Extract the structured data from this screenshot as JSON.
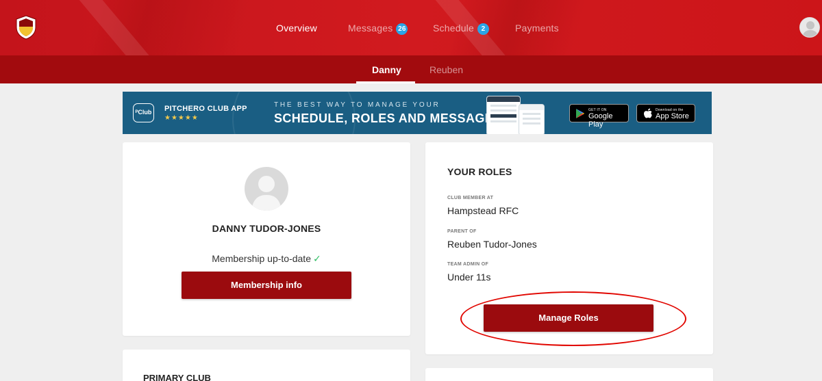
{
  "nav": {
    "overview": "Overview",
    "messages": "Messages",
    "messages_count": "26",
    "schedule": "Schedule",
    "schedule_count": "2",
    "payments": "Payments"
  },
  "subnav": {
    "danny": "Danny",
    "reuben": "Reuben"
  },
  "banner": {
    "logo_text": "ᴾClub",
    "app_name": "PITCHERO CLUB APP",
    "stars": "★★★★★",
    "tagline_small": "THE BEST WAY TO MANAGE YOUR",
    "tagline_big": "SCHEDULE, ROLES AND MESSAGES",
    "google_small": "GET IT ON",
    "google_big": "Google Play",
    "apple_small": "Download on the",
    "apple_big": "App Store"
  },
  "profile": {
    "name": "DANNY TUDOR-JONES",
    "membership_status": "Membership up-to-date",
    "tick": "✓",
    "membership_button": "Membership info"
  },
  "roles": {
    "title": "YOUR ROLES",
    "items": [
      {
        "label": "CLUB MEMBER AT",
        "value": "Hampstead RFC"
      },
      {
        "label": "PARENT OF",
        "value": "Reuben Tudor-Jones"
      },
      {
        "label": "TEAM ADMIN OF",
        "value": "Under 11s"
      }
    ],
    "manage_button": "Manage Roles"
  },
  "primary_club": {
    "title": "PRIMARY CLUB"
  },
  "colors": {
    "brand_red": "#c4141b",
    "dark_red": "#a20b0e",
    "button_red": "#9b0b0e",
    "badge_blue": "#2aa4e6",
    "banner_blue": "#1a5e83",
    "annotation_red": "#e10600"
  }
}
